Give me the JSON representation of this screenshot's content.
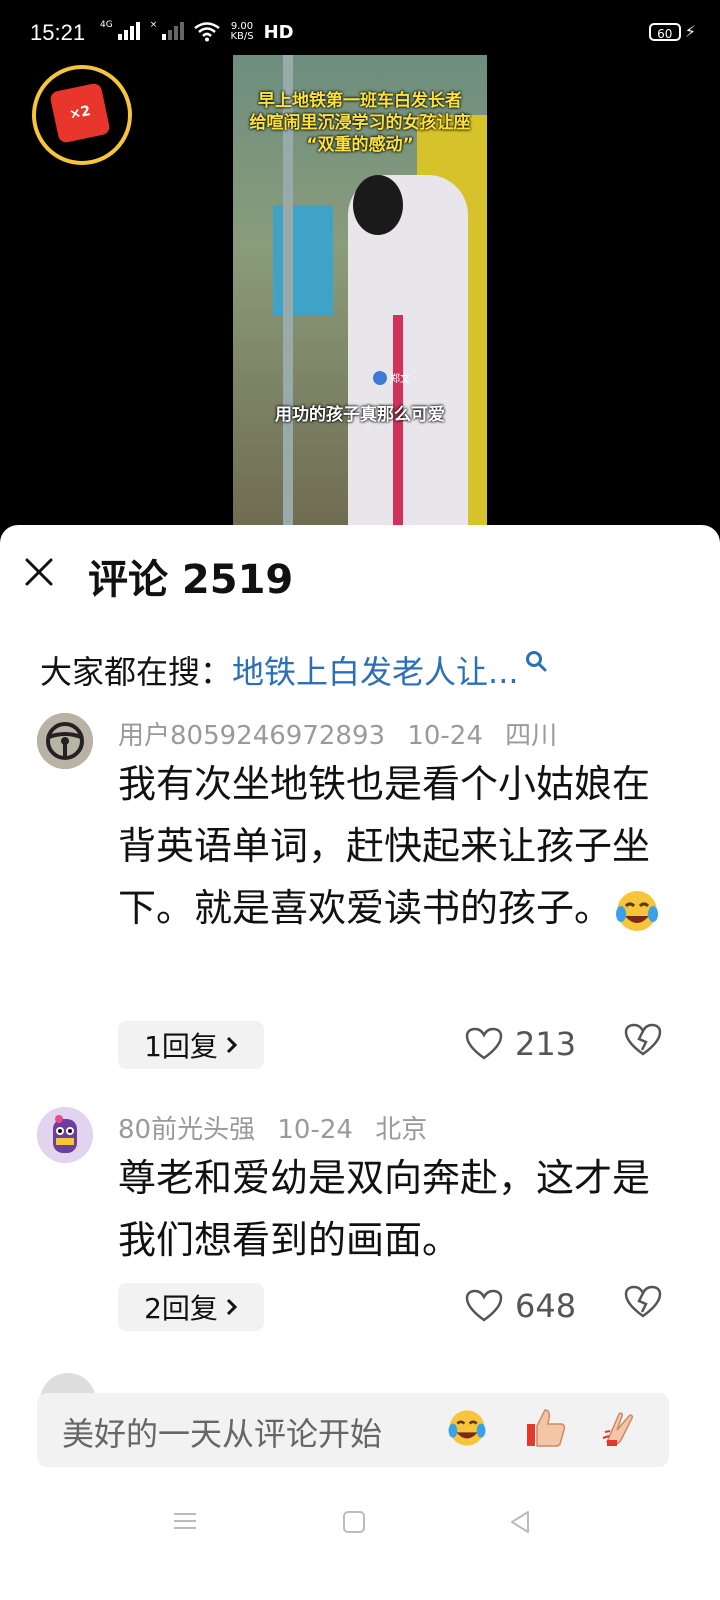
{
  "status_bar": {
    "time": "15:21",
    "network": "4G",
    "net_speed_value": "9.00",
    "net_speed_unit": "KB/S",
    "hd_label": "HD",
    "battery": "60"
  },
  "video": {
    "title_line1": "早上地铁第一班车白发长者",
    "title_line2": "给喧闹里沉浸学习的女孩让座",
    "title_line3": "“双重的感动”",
    "caption": "用功的孩子真那么可爱",
    "watermark": "郑文"
  },
  "reward": {
    "badge": "×2"
  },
  "comments_panel": {
    "title": "评论 2519",
    "search_prefix": "大家都在搜：",
    "search_term": "地铁上白发老人让...",
    "comments": [
      {
        "user": "用户8059246972893",
        "date": "10-24",
        "location": "四川",
        "text": "我有次坐地铁也是看个小姑娘在背英语单词，赶快起来让孩子坐下。就是喜欢爱读书的孩子。",
        "reply_label": "1回复",
        "likes": "213"
      },
      {
        "user": "80前光头强",
        "date": "10-24",
        "location": "北京",
        "text": "尊老和爱幼是双向奔赴，这才是我们想看到的画面。",
        "reply_label": "2回复",
        "likes": "648"
      }
    ],
    "input_placeholder": "美好的一天从评论开始"
  },
  "icons": {
    "close": "close-icon",
    "search": "search-icon",
    "heart": "heart-icon",
    "broken_heart": "broken-heart-icon",
    "chevron": "chevron-right-icon",
    "emoji_laugh": "laughing-crying-emoji",
    "emoji_thumb": "thumbs-up-emoji",
    "emoji_clap": "clapping-hands-emoji"
  },
  "colors": {
    "accent_link": "#2c6fb7",
    "reward_ring": "#f7c53a",
    "reward_envelope": "#e8362c",
    "meta_gray": "#9a9a9a"
  }
}
